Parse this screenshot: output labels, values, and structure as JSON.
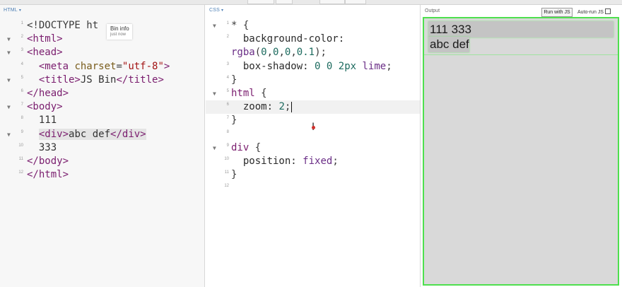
{
  "html_panel": {
    "label": "HTML",
    "tooltip": {
      "title": "Bin info",
      "subtitle": "just now"
    },
    "lines": [
      {
        "n": "1",
        "fold": "",
        "parts": [
          [
            "punct",
            "<!DOCTYPE ht"
          ]
        ]
      },
      {
        "n": "2",
        "fold": "▼",
        "parts": [
          [
            "tag",
            "<html>"
          ]
        ]
      },
      {
        "n": "3",
        "fold": "▼",
        "parts": [
          [
            "tag",
            "<head>"
          ]
        ]
      },
      {
        "n": "4",
        "fold": "",
        "parts": [
          [
            "plain",
            "  "
          ],
          [
            "tag",
            "<meta "
          ],
          [
            "attr",
            "charset"
          ],
          [
            "punct",
            "="
          ],
          [
            "str",
            "\"utf-8\""
          ],
          [
            "tag",
            ">"
          ]
        ]
      },
      {
        "n": "5",
        "fold": "▼",
        "parts": [
          [
            "plain",
            "  "
          ],
          [
            "tag",
            "<title>"
          ],
          [
            "plain",
            "JS Bin"
          ],
          [
            "tag",
            "</title>"
          ]
        ]
      },
      {
        "n": "6",
        "fold": "",
        "parts": [
          [
            "tag",
            "</head>"
          ]
        ]
      },
      {
        "n": "7",
        "fold": "▼",
        "parts": [
          [
            "tag",
            "<body>"
          ]
        ]
      },
      {
        "n": "8",
        "fold": "",
        "parts": [
          [
            "plain",
            "  111"
          ]
        ]
      },
      {
        "n": "9",
        "fold": "▼",
        "hl": true,
        "parts": [
          [
            "plain",
            "  "
          ],
          [
            "tag",
            "<div>"
          ],
          [
            "plain",
            "abc def"
          ],
          [
            "tag",
            "</div>"
          ]
        ]
      },
      {
        "n": "10",
        "fold": "",
        "parts": [
          [
            "plain",
            "  333"
          ]
        ]
      },
      {
        "n": "11",
        "fold": "",
        "parts": [
          [
            "tag",
            "</body>"
          ]
        ]
      },
      {
        "n": "12",
        "fold": "",
        "parts": [
          [
            "tag",
            "</html>"
          ]
        ]
      }
    ]
  },
  "css_panel": {
    "label": "CSS",
    "lines": [
      {
        "n": "1",
        "fold": "▼",
        "parts": [
          [
            "punct",
            "* {"
          ]
        ]
      },
      {
        "n": "2",
        "fold": "",
        "parts": [
          [
            "prop",
            "  background-color:"
          ]
        ]
      },
      {
        "n": "",
        "fold": "",
        "wrap": true,
        "parts": [
          [
            "kw",
            "rgba"
          ],
          [
            "punct",
            "("
          ],
          [
            "num",
            "0"
          ],
          [
            "punct",
            ","
          ],
          [
            "num",
            "0"
          ],
          [
            "punct",
            ","
          ],
          [
            "num",
            "0"
          ],
          [
            "punct",
            ","
          ],
          [
            "num",
            "0.1"
          ],
          [
            "punct",
            ");"
          ]
        ]
      },
      {
        "n": "3",
        "fold": "",
        "parts": [
          [
            "prop",
            "  box-shadow: "
          ],
          [
            "num",
            "0"
          ],
          [
            "plain",
            " "
          ],
          [
            "num",
            "0"
          ],
          [
            "plain",
            " "
          ],
          [
            "num",
            "2px"
          ],
          [
            "plain",
            " "
          ],
          [
            "kw",
            "lime"
          ],
          [
            "punct",
            ";"
          ]
        ]
      },
      {
        "n": "4",
        "fold": "",
        "parts": [
          [
            "punct",
            "}"
          ]
        ]
      },
      {
        "n": "5",
        "fold": "▼",
        "parts": [
          [
            "tag",
            "html"
          ],
          [
            "punct",
            " {"
          ]
        ]
      },
      {
        "n": "6",
        "fold": "",
        "cur": true,
        "parts": [
          [
            "prop",
            "  zoom: "
          ],
          [
            "num",
            "2"
          ],
          [
            "punct",
            ";"
          ]
        ]
      },
      {
        "n": "7",
        "fold": "",
        "parts": [
          [
            "punct",
            "}"
          ]
        ]
      },
      {
        "n": "8",
        "fold": "",
        "parts": []
      },
      {
        "n": "9",
        "fold": "▼",
        "parts": [
          [
            "tag",
            "div"
          ],
          [
            "punct",
            " {"
          ]
        ]
      },
      {
        "n": "10",
        "fold": "",
        "parts": [
          [
            "prop",
            "  position: "
          ],
          [
            "kw",
            "fixed"
          ],
          [
            "punct",
            ";"
          ]
        ]
      },
      {
        "n": "11",
        "fold": "",
        "parts": [
          [
            "punct",
            "}"
          ]
        ]
      },
      {
        "n": "12",
        "fold": "",
        "parts": []
      }
    ]
  },
  "output_panel": {
    "label": "Output",
    "run_button": "Run with JS",
    "autorun_label": "Auto-run JS",
    "render_line1": "111 333",
    "render_line2": "abc def"
  },
  "colors": {
    "lime": "#4ee04e",
    "tag": "#7a1d6e",
    "number": "#1d6b5f"
  }
}
